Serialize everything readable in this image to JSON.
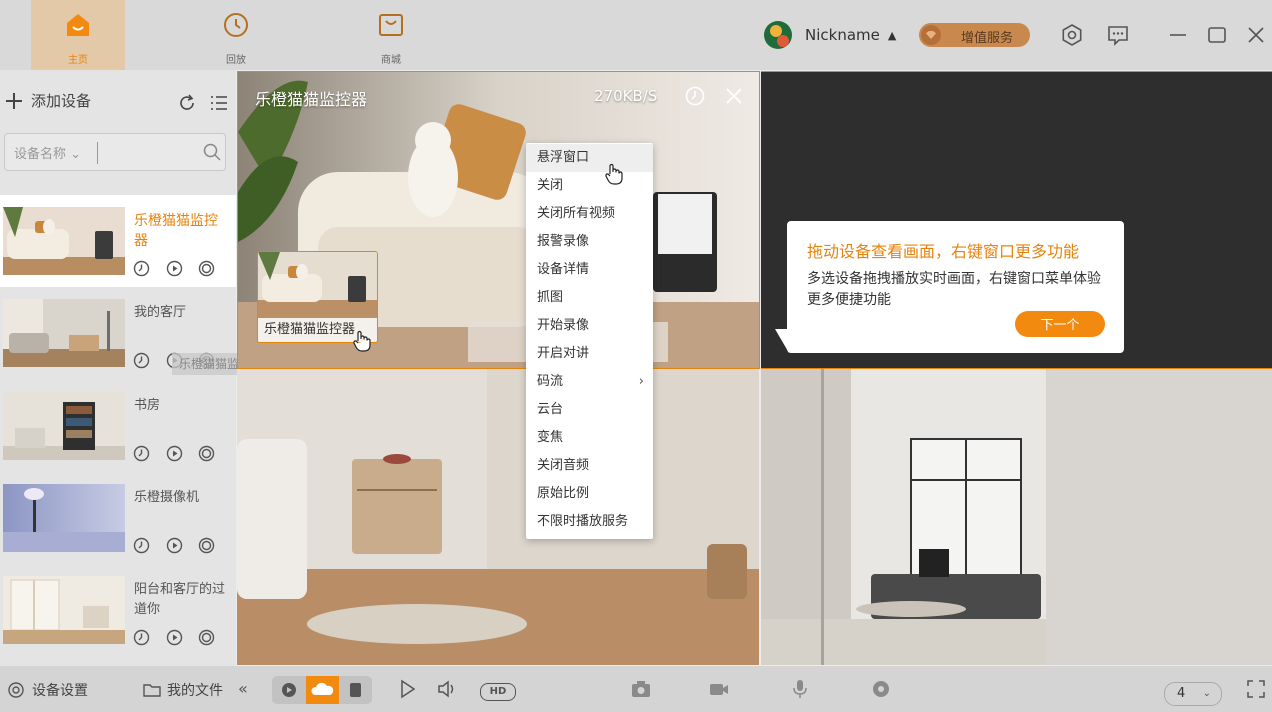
{
  "nav": {
    "tabs": [
      {
        "label": "主页",
        "icon": "home-icon",
        "active": true
      },
      {
        "label": "回放",
        "icon": "clock-icon",
        "active": false
      },
      {
        "label": "商城",
        "icon": "shop-icon",
        "active": false
      }
    ]
  },
  "user": {
    "nickname": "Nickname",
    "caret": "▲"
  },
  "vip": {
    "label": "增值服务"
  },
  "sidebar": {
    "add_label": "添加设备",
    "search_filter": "设备名称 ⌄",
    "search_placeholder": "",
    "devices": [
      {
        "name": "乐橙猫猫监控器",
        "selected": true
      },
      {
        "name": "我的客厅",
        "selected": false
      },
      {
        "name": "书房",
        "selected": false
      },
      {
        "name": "乐橙摄像机",
        "selected": false
      },
      {
        "name": "阳台和客厅的过道你",
        "selected": false
      }
    ],
    "drag_ghost": "乐橙猫猫监控器"
  },
  "player": {
    "title": "乐橙猫猫监控器",
    "speed": "270KB/S",
    "drag_card_label": "乐橙猫猫监控器"
  },
  "context_menu": {
    "items": [
      "悬浮窗口",
      "关闭",
      "关闭所有视频",
      "报警录像",
      "设备详情",
      "抓图",
      "开始录像",
      "开启对讲",
      "码流",
      "云台",
      "变焦",
      "关闭音频",
      "原始比例",
      "不限时播放服务"
    ],
    "submenu_arrow": "›"
  },
  "guide": {
    "title": "拖动设备查看画面，右键窗口更多功能",
    "body": "多选设备拖拽播放实时画面，右键窗口菜单体验更多便捷功能",
    "next_label": "下一个"
  },
  "bottom": {
    "device_settings": "设备设置",
    "my_files": "我的文件",
    "collapse": "«",
    "hd": "HD",
    "grid_count": "4",
    "grid_caret": "⌄"
  },
  "colors": {
    "accent": "#f28a0f",
    "accent_text": "#e8830c",
    "vip": "#c8884e"
  }
}
